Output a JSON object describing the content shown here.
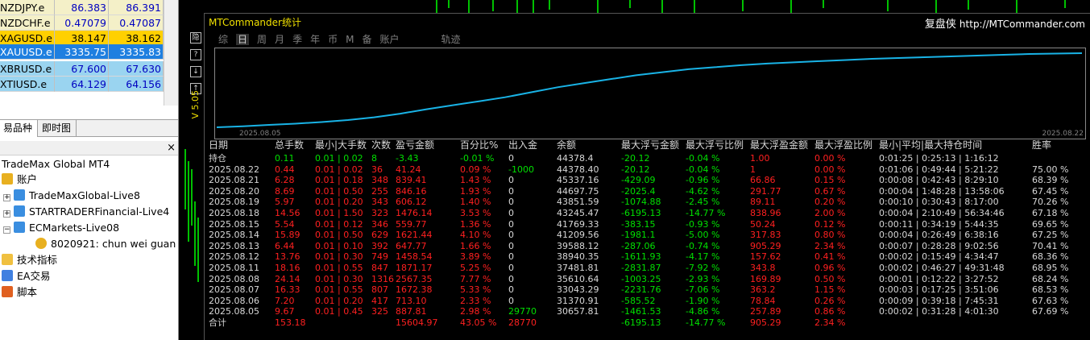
{
  "market_watch": {
    "rows": [
      {
        "symbol": "NZDJPY.e",
        "bid": "86.383",
        "ask": "86.391",
        "bg": "#f4f0c8",
        "color": "#0000c0"
      },
      {
        "symbol": "NZDCHF.e",
        "bid": "0.47079",
        "ask": "0.47087",
        "bg": "#f4f0c8",
        "color": "#0000c0"
      },
      {
        "symbol": "XAGUSD.e",
        "bid": "38.147",
        "ask": "38.162",
        "bg": "#ffd000",
        "color": "#000000"
      },
      {
        "symbol": "XAUUSD.e",
        "bid": "3335.75",
        "ask": "3335.83",
        "bg": "#1e7fe0",
        "color": "#ffffff"
      },
      {
        "symbol": "XBRUSD.e",
        "bid": "67.600",
        "ask": "67.630",
        "bg": "#9ad4f0",
        "color": "#0000c0"
      },
      {
        "symbol": "XTIUSD.e",
        "bid": "64.129",
        "ask": "64.156",
        "bg": "#9ad4f0",
        "color": "#0000c0"
      }
    ],
    "tabs": [
      "易品种",
      "即时图"
    ]
  },
  "navigator": {
    "root": "TradeMax Global MT4",
    "accounts": "账户",
    "servers": [
      "TradeMaxGlobal-Live8",
      "STARTRADERFinancial-Live4",
      "ECMarkets-Live08"
    ],
    "user": "8020921: chun wei guan",
    "items": [
      "技术指标",
      "EA交易",
      "脚本"
    ]
  },
  "side_buttons": [
    "隐",
    "?",
    "↓",
    "↑"
  ],
  "vertical_label": "V 5.05",
  "panel": {
    "title": "MTCommander统计",
    "brand": "复盘侠",
    "url": "http://MTCommander.com",
    "tabs": [
      "综",
      "日",
      "周",
      "月",
      "季",
      "年",
      "币",
      "M",
      "备",
      "账户",
      "轨迹"
    ],
    "active_tab": "日",
    "headers": [
      "日期",
      "总手数",
      "最小|大手数",
      "次数",
      "盈亏金额",
      "百分比%",
      "出入金",
      "余额",
      "最大浮亏金额",
      "最大浮亏比例",
      "最大浮盈金额",
      "最大浮盈比例",
      "最小|平均|最大持仓时间",
      "胜率"
    ],
    "rows": [
      {
        "c": [
          "持仓",
          "0.11",
          "0.01 | 0.02",
          "8",
          "-3.43",
          "-0.01 %",
          "0",
          "44378.4",
          "-20.12",
          "-0.04 %",
          "1.00",
          "0.00 %",
          "0:01:25 | 0:25:13 | 1:16:12",
          ""
        ],
        "k": "g"
      },
      {
        "c": [
          "2025.08.22",
          "0.44",
          "0.01 | 0.02",
          "36",
          "41.24",
          "0.09 %",
          "-1000",
          "44378.40",
          "-20.12",
          "-0.04 %",
          "1",
          "0.00 %",
          "0:01:06 | 0:49:44 | 5:21:22",
          "75.00 %"
        ],
        "k": "r"
      },
      {
        "c": [
          "2025.08.21",
          "6.28",
          "0.01 | 0.18",
          "348",
          "839.41",
          "1.43 %",
          "0",
          "45337.16",
          "-429.09",
          "-0.96 %",
          "66.86",
          "0.15 %",
          "0:00:08 | 0:42:43 | 8:29:10",
          "68.39 %"
        ],
        "k": "r"
      },
      {
        "c": [
          "2025.08.20",
          "8.69",
          "0.01 | 0.50",
          "255",
          "846.16",
          "1.93 %",
          "0",
          "44697.75",
          "-2025.4",
          "-4.62 %",
          "291.77",
          "0.67 %",
          "0:00:04 | 1:48:28 | 13:58:06",
          "67.45 %"
        ],
        "k": "r"
      },
      {
        "c": [
          "2025.08.19",
          "5.97",
          "0.01 | 0.20",
          "343",
          "606.12",
          "1.40 %",
          "0",
          "43851.59",
          "-1074.88",
          "-2.45 %",
          "89.11",
          "0.20 %",
          "0:00:10 | 0:30:43 | 8:17:00",
          "70.26 %"
        ],
        "k": "r"
      },
      {
        "c": [
          "2025.08.18",
          "14.56",
          "0.01 | 1.50",
          "323",
          "1476.14",
          "3.53 %",
          "0",
          "43245.47",
          "-6195.13",
          "-14.77 %",
          "838.96",
          "2.00 %",
          "0:00:04 | 2:10:49 | 56:34:46",
          "67.18 %"
        ],
        "k": "r"
      },
      {
        "c": [
          "2025.08.15",
          "5.54",
          "0.01 | 0.12",
          "346",
          "559.77",
          "1.36 %",
          "0",
          "41769.33",
          "-383.15",
          "-0.93 %",
          "50.24",
          "0.12 %",
          "0:00:11 | 0:34:19 | 5:44:35",
          "69.65 %"
        ],
        "k": "r"
      },
      {
        "c": [
          "2025.08.14",
          "15.89",
          "0.01 | 0.50",
          "629",
          "1621.44",
          "4.10 %",
          "0",
          "41209.56",
          "-1981.1",
          "-5.00 %",
          "317.83",
          "0.80 %",
          "0:00:04 | 0:26:49 | 6:38:16",
          "67.25 %"
        ],
        "k": "r"
      },
      {
        "c": [
          "2025.08.13",
          "6.44",
          "0.01 | 0.10",
          "392",
          "647.77",
          "1.66 %",
          "0",
          "39588.12",
          "-287.06",
          "-0.74 %",
          "905.29",
          "2.34 %",
          "0:00:07 | 0:28:28 | 9:02:56",
          "70.41 %"
        ],
        "k": "r"
      },
      {
        "c": [
          "2025.08.12",
          "13.76",
          "0.01 | 0.30",
          "749",
          "1458.54",
          "3.89 %",
          "0",
          "38940.35",
          "-1611.93",
          "-4.17 %",
          "157.62",
          "0.41 %",
          "0:00:02 | 0:15:49 | 4:34:47",
          "68.36 %"
        ],
        "k": "r"
      },
      {
        "c": [
          "2025.08.11",
          "18.16",
          "0.01 | 0.55",
          "847",
          "1871.17",
          "5.25 %",
          "0",
          "37481.81",
          "-2831.87",
          "-7.92 %",
          "343.8",
          "0.96 %",
          "0:00:02 | 0:46:27 | 49:31:48",
          "68.95 %"
        ],
        "k": "r"
      },
      {
        "c": [
          "2025.08.08",
          "24.14",
          "0.01 | 0.30",
          "1316",
          "2567.35",
          "7.77 %",
          "0",
          "35610.64",
          "-1003.25",
          "-2.93 %",
          "169.89",
          "0.50 %",
          "0:00:01 | 0:12:22 | 3:27:52",
          "68.24 %"
        ],
        "k": "r"
      },
      {
        "c": [
          "2025.08.07",
          "16.33",
          "0.01 | 0.55",
          "807",
          "1672.38",
          "5.33 %",
          "0",
          "33043.29",
          "-2231.76",
          "-7.06 %",
          "363.2",
          "1.15 %",
          "0:00:03 | 0:17:25 | 3:51:06",
          "68.53 %"
        ],
        "k": "r"
      },
      {
        "c": [
          "2025.08.06",
          "7.20",
          "0.01 | 0.20",
          "417",
          "713.10",
          "2.33 %",
          "0",
          "31370.91",
          "-585.52",
          "-1.90 %",
          "78.84",
          "0.26 %",
          "0:00:09 | 0:39:18 | 7:45:31",
          "67.63 %"
        ],
        "k": "r"
      },
      {
        "c": [
          "2025.08.05",
          "9.67",
          "0.01 | 0.45",
          "325",
          "887.81",
          "2.98 %",
          "29770",
          "30657.81",
          "-1461.53",
          "-4.86 %",
          "257.89",
          "0.86 %",
          "0:00:02 | 0:31:28 | 4:01:30",
          "67.69 %"
        ],
        "k": "r"
      },
      {
        "c": [
          "合计",
          "153.18",
          "",
          "",
          "15604.97",
          "43.05 %",
          "28770",
          "",
          "-6195.13",
          "-14.77 %",
          "905.29",
          "2.34 %",
          "",
          ""
        ],
        "k": "t"
      }
    ]
  },
  "chart_data": {
    "type": "line",
    "x_start_label": "2025.08.05",
    "x_end_label": "2025.08.22",
    "series": [
      {
        "values": [
          0,
          5,
          12,
          18,
          26,
          36,
          50,
          68,
          90,
          110,
          130,
          150,
          175,
          200,
          220,
          240,
          260,
          275,
          290,
          300,
          310,
          318,
          324,
          330,
          336,
          342,
          346,
          350,
          354,
          358,
          362,
          366,
          368,
          370
        ]
      }
    ],
    "colors": {
      "line": "#19b3e6",
      "pos": "#00e000",
      "neg": "#ff2020",
      "text": "#d8d8d8"
    }
  }
}
